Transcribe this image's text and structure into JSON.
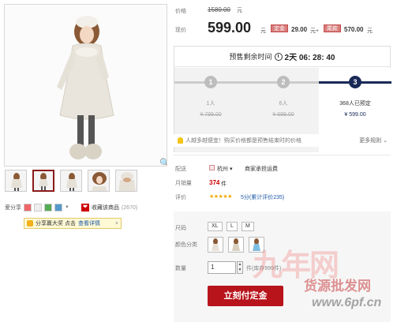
{
  "product": {
    "thumb_count": 5,
    "selected_thumb_index": 1
  },
  "share": {
    "label": "爱分享",
    "fav_label": "收藏该商品",
    "fav_count": "(2670)",
    "popup_text": "分享赢大奖 点击",
    "popup_link": "查看详情",
    "popup_close": "×"
  },
  "price": {
    "original_label": "价格",
    "original_value": "1580.00",
    "original_unit": "元",
    "current_label": "现价",
    "current_value": "599.00",
    "current_unit": "元",
    "deposit_tag": "定金",
    "deposit_value": "29.00",
    "deposit_unit": "元+",
    "balance_tag": "尾款",
    "balance_value": "570.00",
    "balance_unit": "元"
  },
  "presale": {
    "countdown_label": "预售剩余时间",
    "countdown_value": "2天 06: 28: 40",
    "steps": [
      {
        "num": "1",
        "text": "1人",
        "price": "¥ 799.00"
      },
      {
        "num": "2",
        "text": "6人",
        "price": "¥ 699.00"
      },
      {
        "num": "3",
        "text": "368人已预定",
        "price": "¥ 599.00"
      }
    ],
    "tip": "人越多越便宜！购买价格都是预售结束时的价格",
    "more_rules": "更多规则"
  },
  "info": {
    "ship_label": "配送",
    "ship_city": "杭州",
    "ship_note": "商家承担运费",
    "sales_label": "月销量",
    "sales_value": "374",
    "sales_unit": "件",
    "rating_label": "评价",
    "rating_stars": "★★★★★",
    "rating_text": "5分(累计评价235)"
  },
  "buy": {
    "size_label": "尺码",
    "sizes": [
      "XL",
      "L",
      "M"
    ],
    "color_label": "颜色分类",
    "qty_label": "数量",
    "qty_value": "1",
    "stock_text": "件(库存999件)",
    "buy_button": "立刻付定金"
  },
  "watermark": {
    "logo": "九年网",
    "text": "货源批发网",
    "url": "www.6pf.cn"
  },
  "colors": {
    "accent_red": "#b8141b",
    "navy": "#1a2a57"
  }
}
